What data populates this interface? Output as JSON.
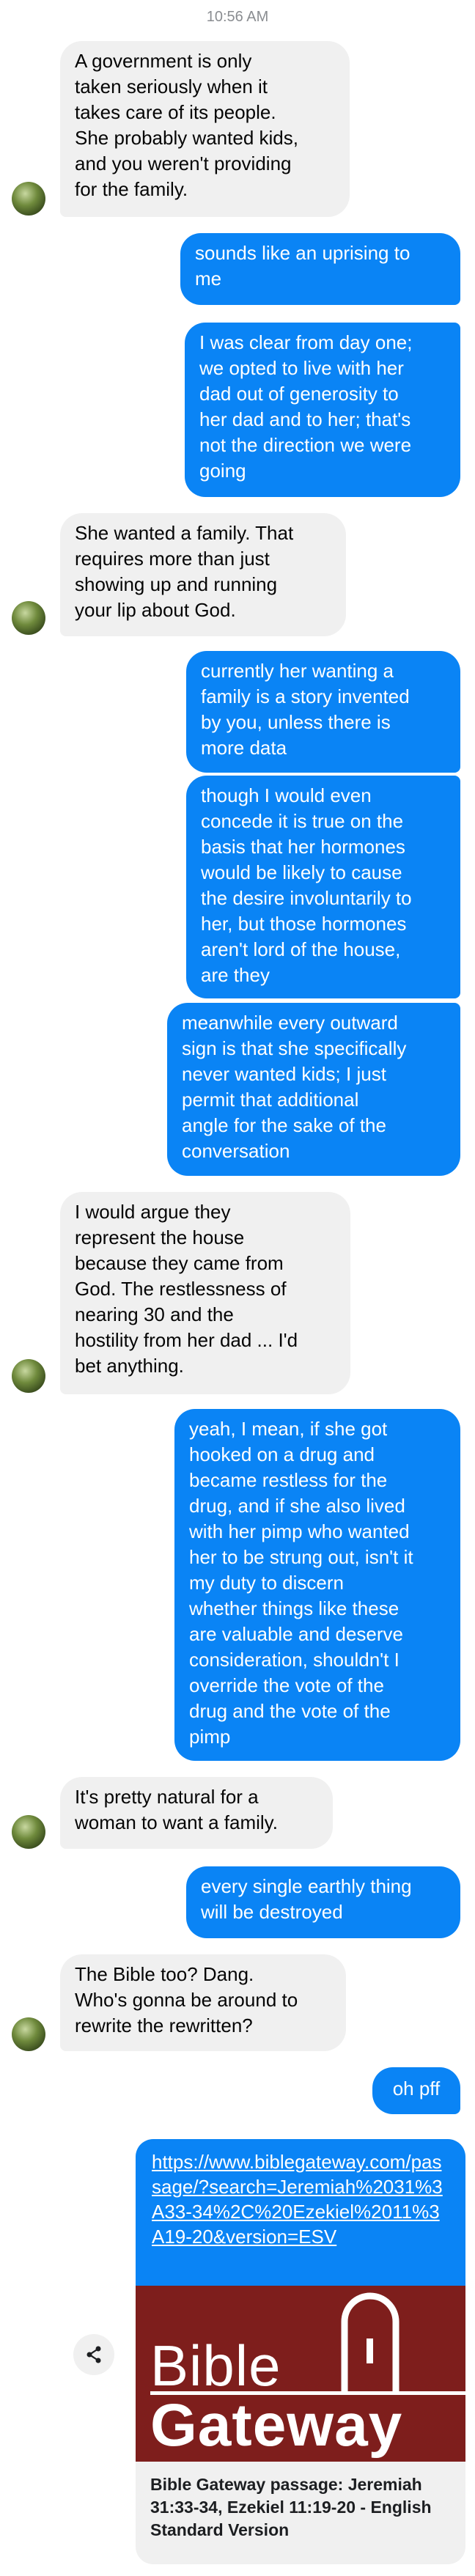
{
  "status": {
    "time": "10:56 AM"
  },
  "messages": [
    {
      "side": "in",
      "text": "A government is only\ntaken seriously when it\ntakes care of its people.\nShe probably wanted kids,\nand you weren't providing\nfor the family."
    },
    {
      "side": "out",
      "text": "sounds like an uprising to\nme"
    },
    {
      "side": "out",
      "text": "I was clear from day one;\nwe opted to live with her\ndad out of generosity to\nher dad and to her; that's\nnot the direction we were\ngoing"
    },
    {
      "side": "in",
      "text": "She wanted a family. That\nrequires more than just\nshowing up and running\nyour lip about God."
    },
    {
      "side": "out",
      "text": "currently her wanting a\nfamily is a story invented\nby you, unless there is\nmore data"
    },
    {
      "side": "out",
      "text": "though I would even\nconcede it is true on the\nbasis that her hormones\nwould be likely to cause\nthe desire involuntarily to\nher, but those hormones\naren't lord of the house,\nare they"
    },
    {
      "side": "out",
      "text": "meanwhile every outward\nsign is that she specifically\nnever wanted kids; I just\npermit that additional\nangle for the sake of the\nconversation"
    },
    {
      "side": "in",
      "text": "I would argue they\nrepresent the house\nbecause they came from\nGod. The restlessness of\nnearing 30 and the\nhostility from her dad ... I'd\nbet anything."
    },
    {
      "side": "out",
      "text": "yeah, I mean, if she got\nhooked on a drug and\nbecame restless for the\ndrug, and if she also lived\nwith her pimp who wanted\nher to be strung out, isn't it\nmy duty to discern\nwhether things like these\nare valuable and deserve\nconsideration, shouldn't I\noverride the vote of the\ndrug and the vote of the\npimp"
    },
    {
      "side": "in",
      "text": "It's pretty natural for a\nwoman to want a family."
    },
    {
      "side": "out",
      "text": "every single earthly thing\nwill be destroyed"
    },
    {
      "side": "in",
      "text": "The Bible too? Dang.\nWho's gonna be around to\nrewrite the rewritten?"
    },
    {
      "side": "out",
      "text": "oh pff"
    }
  ],
  "link": {
    "url": "https://www.biblegateway.com/passage/?search=Jeremiah%2031%3A33-34%2C%20Ezekiel%2011%3A19-20&version=ESV",
    "logo_line1": "Bible",
    "logo_line2": "Gateway",
    "title": "Bible Gateway passage: Jeremiah 31:33-34, Ezekiel 11:19-20 - English Standard Version"
  },
  "icons": {
    "share": "share-icon",
    "avatar": "contact-avatar"
  },
  "colors": {
    "outgoing": "#0a84f5",
    "incoming": "#f0f0f0",
    "logo_bg": "#7e1e1c"
  }
}
